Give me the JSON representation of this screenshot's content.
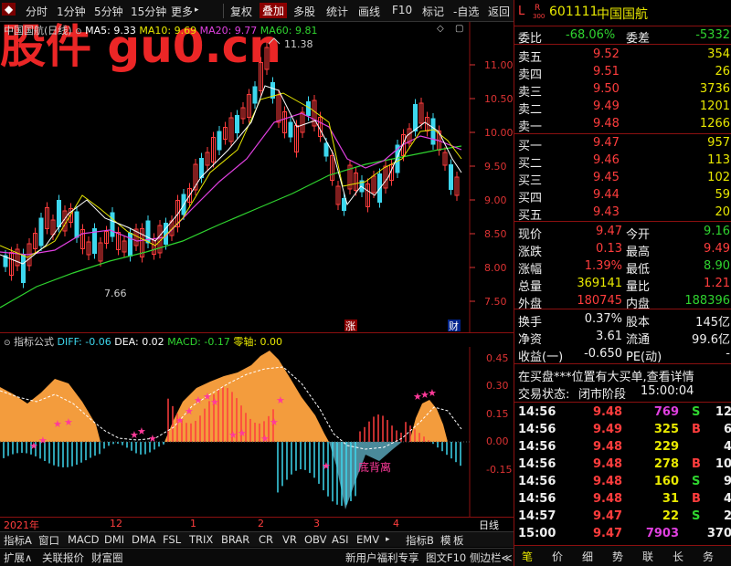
{
  "toolbar": {
    "items": [
      "分时",
      "1分钟",
      "5分钟",
      "15分钟",
      "更多",
      "复权",
      "叠加",
      "多股",
      "统计",
      "画线",
      "F10",
      "标记",
      "-自选",
      "返回"
    ],
    "more_arrow": "▸"
  },
  "main_chart": {
    "name": "中国国航(日线)",
    "ma5": "MA5: 9.33",
    "ma10": "MA10: 9.69",
    "ma20": "MA20: 9.77",
    "ma60": "MA60: 9.81",
    "high_label": "11.38",
    "low_label": "7.66",
    "price_axis": [
      "11.00",
      "10.50",
      "10.00",
      "9.50",
      "9.00",
      "8.50",
      "8.00",
      "7.50"
    ],
    "flag_zhang": "涨",
    "flag_cai": "财",
    "watermark": "股件 gu0.cn"
  },
  "indicator": {
    "name": "指标公式",
    "diff": "DIFF: -0.06",
    "dea": "DEA: 0.02",
    "macd": "MACD: -0.17",
    "zero": "零轴: 0.00",
    "axis": [
      "0.45",
      "0.30",
      "0.15",
      "0.00",
      "-0.15"
    ],
    "annotation": "底背离"
  },
  "x_axis": {
    "labels": [
      "2021年",
      "12",
      "1",
      "2",
      "3",
      "4"
    ],
    "right": "日线"
  },
  "tabs": [
    "指标A",
    "窗口",
    "MACD",
    "DMI",
    "DMA",
    "FSL",
    "TRIX",
    "BRAR",
    "CR",
    "VR",
    "OBV",
    "ASI",
    "EMV"
  ],
  "tabs_right": [
    "指标B",
    "模",
    "板"
  ],
  "statusbar": {
    "left": [
      "扩展∧",
      "关联报价",
      "财富圈"
    ],
    "right": [
      "新用户福利专享",
      "图文F10",
      "侧边栏≪"
    ]
  },
  "right_panel": {
    "badge_l": "L",
    "badge_r": "R",
    "badge_num": "300",
    "code": "601111",
    "name": "中国国航",
    "weibi_label": "委比",
    "weibi": "-68.06%",
    "weicha_label": "委差",
    "weicha": "-5332",
    "asks": [
      {
        "label": "卖五",
        "price": "9.52",
        "vol": "354"
      },
      {
        "label": "卖四",
        "price": "9.51",
        "vol": "26"
      },
      {
        "label": "卖三",
        "price": "9.50",
        "vol": "3736"
      },
      {
        "label": "卖二",
        "price": "9.49",
        "vol": "1201"
      },
      {
        "label": "卖一",
        "price": "9.48",
        "vol": "1266"
      }
    ],
    "bids": [
      {
        "label": "买一",
        "price": "9.47",
        "vol": "957"
      },
      {
        "label": "买二",
        "price": "9.46",
        "vol": "113"
      },
      {
        "label": "买三",
        "price": "9.45",
        "vol": "102"
      },
      {
        "label": "买四",
        "price": "9.44",
        "vol": "59"
      },
      {
        "label": "买五",
        "price": "9.43",
        "vol": "20"
      }
    ],
    "quote": [
      {
        "l1": "现价",
        "v1": "9.47",
        "c1": "red",
        "l2": "今开",
        "v2": "9.16",
        "c2": "green"
      },
      {
        "l1": "涨跌",
        "v1": "0.13",
        "c1": "red",
        "l2": "最高",
        "v2": "9.49",
        "c2": "red"
      },
      {
        "l1": "涨幅",
        "v1": "1.39%",
        "c1": "red",
        "l2": "最低",
        "v2": "8.90",
        "c2": "green"
      },
      {
        "l1": "总量",
        "v1": "369141",
        "c1": "yellow",
        "l2": "量比",
        "v2": "1.21",
        "c2": "red"
      },
      {
        "l1": "外盘",
        "v1": "180745",
        "c1": "red",
        "l2": "内盘",
        "v2": "188396",
        "c2": "green"
      }
    ],
    "stats": [
      {
        "l1": "换手",
        "v1": "0.37%",
        "l2": "股本",
        "v2": "145亿"
      },
      {
        "l1": "净资",
        "v1": "3.61",
        "l2": "流通",
        "v2": "99.6亿"
      },
      {
        "l1": "收益(一)",
        "v1": "-0.650",
        "l2": "PE(动)",
        "v2": "-"
      }
    ],
    "notice": "在买盘***位置有大买单,查看详情",
    "trade_status_label": "交易状态:",
    "trade_status": "闭市阶段",
    "trade_time": "15:00:04",
    "ticks": [
      {
        "t": "14:56",
        "p": "9.48",
        "v": "769",
        "s": "S",
        "n": "12",
        "vc": "magenta",
        "sc": "green"
      },
      {
        "t": "14:56",
        "p": "9.49",
        "v": "325",
        "s": "B",
        "n": "6",
        "vc": "yellow",
        "sc": "red"
      },
      {
        "t": "14:56",
        "p": "9.48",
        "v": "229",
        "s": "",
        "n": "4",
        "vc": "yellow",
        "sc": "white"
      },
      {
        "t": "14:56",
        "p": "9.48",
        "v": "278",
        "s": "B",
        "n": "10",
        "vc": "yellow",
        "sc": "red"
      },
      {
        "t": "14:56",
        "p": "9.48",
        "v": "160",
        "s": "S",
        "n": "9",
        "vc": "yellow",
        "sc": "green"
      },
      {
        "t": "14:56",
        "p": "9.48",
        "v": "31",
        "s": "B",
        "n": "4",
        "vc": "yellow",
        "sc": "red"
      },
      {
        "t": "14:57",
        "p": "9.47",
        "v": "22",
        "s": "S",
        "n": "2",
        "vc": "yellow",
        "sc": "green"
      },
      {
        "t": "15:00",
        "p": "9.47",
        "v": "7903",
        "s": "",
        "n": "370",
        "vc": "magenta",
        "sc": "white"
      }
    ],
    "bottom_tabs": [
      "笔",
      "价",
      "细",
      "势",
      "联",
      "长",
      "务"
    ]
  }
}
